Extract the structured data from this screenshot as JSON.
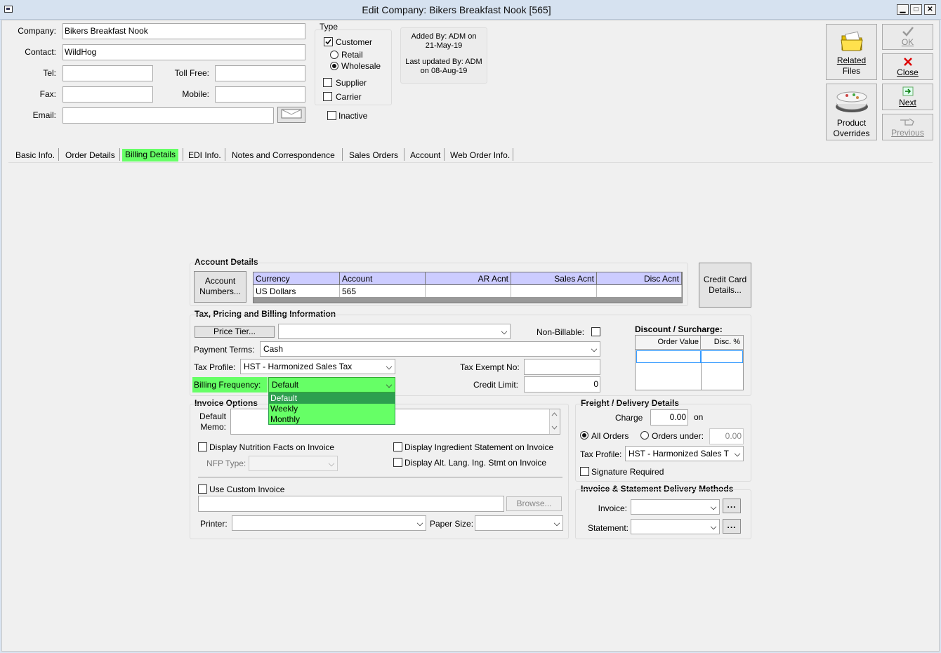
{
  "window": {
    "title": "Edit Company: Bikers Breakfast Nook [565]",
    "min": "▁",
    "max": "□",
    "close": "✕"
  },
  "contact": {
    "company_label": "Company:",
    "company_value": "Bikers Breakfast Nook",
    "contact_label": "Contact:",
    "contact_value": "WildHog",
    "tel_label": "Tel:",
    "tel_value": "",
    "tollfree_label": "Toll Free:",
    "tollfree_value": "",
    "fax_label": "Fax:",
    "fax_value": "",
    "mobile_label": "Mobile:",
    "mobile_value": "",
    "email_label": "Email:",
    "email_value": ""
  },
  "type": {
    "title": "Type",
    "customer": "Customer",
    "customer_checked": true,
    "retail": "Retail",
    "wholesale": "Wholesale",
    "selected": "Wholesale",
    "supplier": "Supplier",
    "carrier": "Carrier",
    "inactive": "Inactive"
  },
  "audit": {
    "added_by": "Added By: ADM on",
    "added_date": "21-May-19",
    "updated_by": "Last updated By: ADM",
    "updated_date": "on 08-Aug-19"
  },
  "buttons": {
    "related_files_1": "Related",
    "related_files_2": "Files",
    "ok": "OK",
    "close": "Close",
    "product_overrides_1": "Product",
    "product_overrides_2": "Overrides",
    "next": "Next",
    "previous": "Previous"
  },
  "tabs": [
    "Basic Info.",
    "Order Details",
    "Billing Details",
    "EDI Info.",
    "Notes and Correspondence",
    "Sales Orders",
    "Account",
    "Web Order Info."
  ],
  "active_tab": "Billing Details",
  "account": {
    "header": "Account Details",
    "numbers_btn_1": "Account",
    "numbers_btn_2": "Numbers...",
    "columns": [
      "Currency",
      "Account",
      "AR Acnt",
      "Sales Acnt",
      "Disc Acnt"
    ],
    "row": [
      "US Dollars",
      "565",
      "",
      "",
      ""
    ],
    "cc_btn_1": "Credit Card",
    "cc_btn_2": "Details..."
  },
  "tax": {
    "header": "Tax, Pricing and Billing Information",
    "price_tier_btn": "Price Tier...",
    "price_tier_value": "",
    "non_billable_label": "Non-Billable:",
    "payment_terms_label": "Payment Terms:",
    "payment_terms_value": "Cash",
    "tax_profile_label": "Tax Profile:",
    "tax_profile_value": "HST - Harmonized Sales Tax",
    "tax_exempt_label": "Tax Exempt No:",
    "tax_exempt_value": "",
    "billing_freq_label": "Billing Frequency:",
    "billing_freq_value": "Default",
    "billing_freq_options": [
      "Default",
      "Weekly",
      "Monthly"
    ],
    "credit_limit_label": "Credit Limit:",
    "credit_limit_value": "0"
  },
  "discount": {
    "header": "Discount / Surcharge:",
    "col_order": "Order Value",
    "col_disc": "Disc. %"
  },
  "invoice": {
    "header": "Invoice Options",
    "memo_label_1": "Default",
    "memo_label_2": "Memo:",
    "nutrition": "Display Nutrition Facts on Invoice",
    "ingredient": "Display Ingredient Statement on Invoice",
    "nfp_label": "NFP Type:",
    "alt_lang": "Display Alt. Lang. Ing. Stmt on Invoice",
    "custom": "Use Custom Invoice",
    "browse": "Browse...",
    "printer_label": "Printer:",
    "paper_label": "Paper Size:"
  },
  "freight": {
    "header": "Freight / Delivery Details",
    "charge_label": "Charge",
    "charge_value": "0.00",
    "on_label": "on",
    "all_orders": "All Orders",
    "orders_under": "Orders under:",
    "orders_under_value": "0.00",
    "tax_profile_label": "Tax Profile:",
    "tax_profile_value": "HST - Harmonized Sales T",
    "signature": "Signature Required"
  },
  "delivery": {
    "header": "Invoice & Statement Delivery Methods",
    "invoice_label": "Invoice:",
    "statement_label": "Statement:",
    "ellipsis": "..."
  },
  "colors": {
    "accent_green": "#66ff66",
    "highlight_green": "#2d9f4f",
    "grid_header": "#ccccff"
  }
}
